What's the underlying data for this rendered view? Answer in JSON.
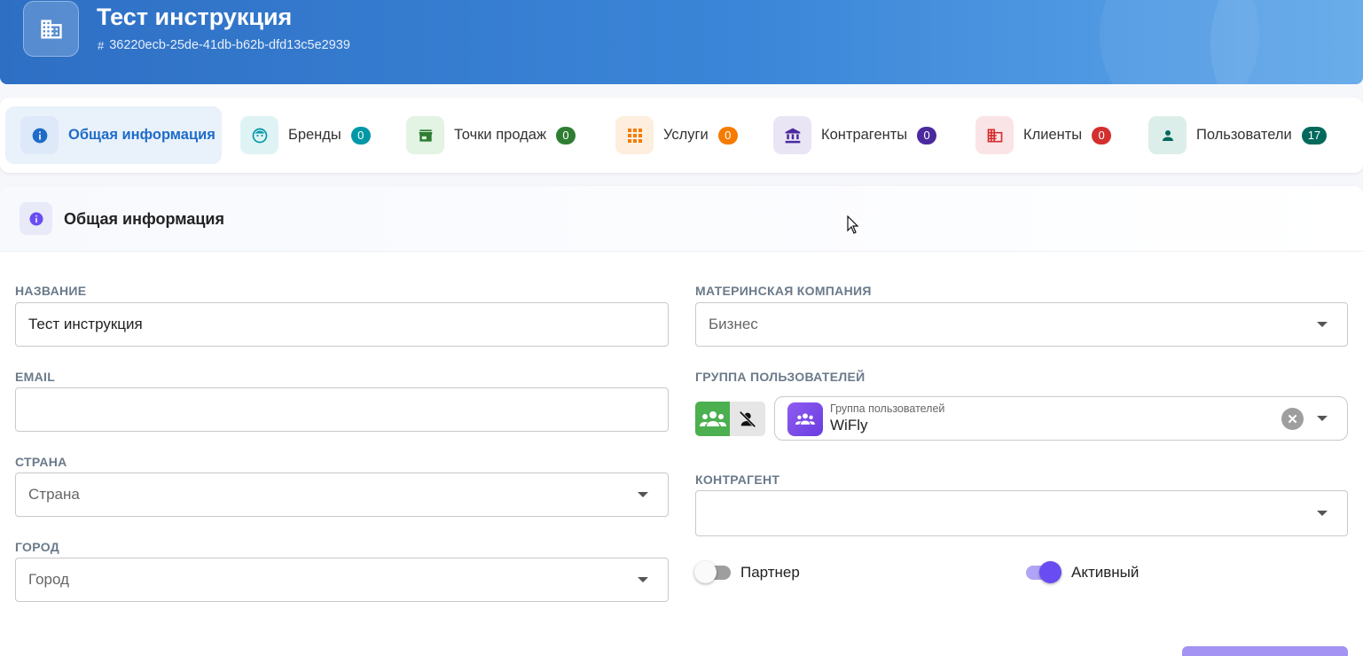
{
  "header": {
    "title": "Тест инструкция",
    "id": "36220ecb-25de-41db-b62b-dfd13c5e2939",
    "icon": "building-icon"
  },
  "tabs": [
    {
      "label": "Общая информация",
      "icon": "info-icon",
      "active": true
    },
    {
      "label": "Бренды",
      "icon": "brand-face-icon",
      "count": "0",
      "color": "#0097a7"
    },
    {
      "label": "Точки продаж",
      "icon": "store-icon",
      "count": "0",
      "color": "#2e7d32"
    },
    {
      "label": "Услуги",
      "icon": "apps-grid-icon",
      "count": "0",
      "color": "#f57c00"
    },
    {
      "label": "Контрагенты",
      "icon": "bank-icon",
      "count": "0",
      "color": "#4a2a9e"
    },
    {
      "label": "Клиенты",
      "icon": "building-icon",
      "count": "0",
      "color": "#d32f2f"
    },
    {
      "label": "Пользователи",
      "icon": "person-icon",
      "count": "17",
      "color": "#00695c"
    }
  ],
  "section": {
    "title": "Общая информация",
    "icon": "info-icon"
  },
  "form": {
    "name_label": "НАЗВАНИЕ",
    "name_value": "Тест инструкция",
    "email_label": "EMAIL",
    "email_value": "",
    "country_label": "СТРАНА",
    "country_placeholder": "Страна",
    "city_label": "ГОРОД",
    "city_placeholder": "Город",
    "parent_label": "МАТЕРИНСКАЯ КОМПАНИЯ",
    "parent_value": "Бизнес",
    "group_label": "ГРУППА ПОЛЬЗОВАТЕЛЕЙ",
    "group_field_label": "Группа пользователей",
    "group_value": "WiFly",
    "counterparty_label": "КОНТРАГЕНТ",
    "counterparty_value": "",
    "partner_label": "Партнер",
    "partner_on": false,
    "active_label": "Активный",
    "active_on": true
  },
  "colors": {
    "accent": "#1e6cc8",
    "switch_on": "#6a4df2"
  }
}
